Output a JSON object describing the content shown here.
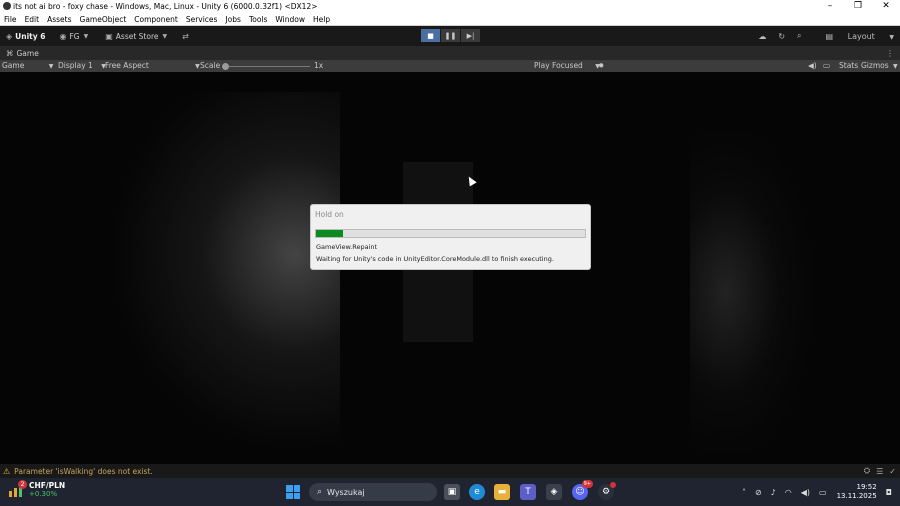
{
  "window": {
    "title": "its not ai bro - foxy chase - Windows, Mac, Linux - Unity 6 (6000.0.32f1) <DX12>",
    "controls": [
      "–",
      "❐",
      "✕"
    ]
  },
  "menu": [
    "File",
    "Edit",
    "Assets",
    "GameObject",
    "Component",
    "Services",
    "Jobs",
    "Tools",
    "Window",
    "Help"
  ],
  "toolbar": {
    "unity_label": "Unity 6",
    "account_label": "FG",
    "asset_store_label": "Asset Store",
    "layout_label": "Layout"
  },
  "panel_tab": {
    "label": "Game"
  },
  "game_toolbar": {
    "mode": "Game",
    "display": "Display 1",
    "aspect": "Free Aspect",
    "scale_label": "Scale",
    "scale_value": "1x",
    "play_mode": "Play Focused",
    "stats": "Stats",
    "gizmos": "Gizmos"
  },
  "dialog": {
    "title": "Hold on",
    "progress": 0.1,
    "info": "GameView.Repaint",
    "message": "Waiting for Unity's code in UnityEditor.CoreModule.dll to finish executing."
  },
  "status": {
    "warning": "Parameter 'isWalking' does not exist."
  },
  "taskbar": {
    "widget_badge": "2",
    "widget_pair": "CHF/PLN",
    "widget_change": "+0.30%",
    "search_placeholder": "Wyszukaj",
    "discord_badge": "9+",
    "time": "19:52",
    "date": "13.11.2025"
  },
  "colors": {
    "progress_fill": "#0b8a1f",
    "warning": "#e8b43a",
    "accent": "#4a6fa0"
  }
}
